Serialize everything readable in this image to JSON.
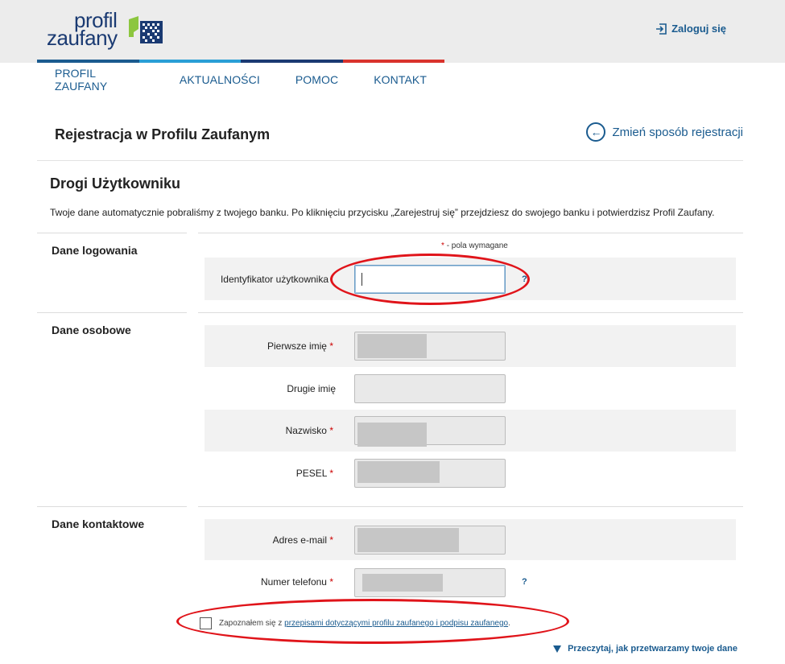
{
  "header": {
    "logo_line1": "profil",
    "logo_line2": "zaufany",
    "login_label": "Zaloguj się",
    "colorbar_colors": [
      "#1a5b8f",
      "#2a9fd6",
      "#1a3a72",
      "#d9332c"
    ]
  },
  "nav": {
    "items": [
      {
        "label": "PROFIL ZAUFANY"
      },
      {
        "label": "AKTUALNOŚCI"
      },
      {
        "label": "POMOC"
      },
      {
        "label": "KONTAKT"
      }
    ]
  },
  "page": {
    "title": "Rejestracja w Profilu Zaufanym",
    "change_label": "Zmień sposób rejestracji",
    "greeting": "Drogi Użytkowniku",
    "intro": "Twoje dane automatycznie pobraliśmy z twojego banku. Po kliknięciu przycisku „Zarejestruj się” przejdziesz do swojego banku i potwierdzisz Profil Zaufany.",
    "required_note": "- pola wymagane",
    "required_star": "*"
  },
  "sections": {
    "login": {
      "title": "Dane logowania",
      "username_label": "Identyfikator użytkownika",
      "username_value": "",
      "help": "?"
    },
    "personal": {
      "title": "Dane osobowe",
      "first_name_label": "Pierwsze imię",
      "second_name_label": "Drugie imię",
      "surname_label": "Nazwisko",
      "pesel_label": "PESEL"
    },
    "contact": {
      "title": "Dane kontaktowe",
      "email_label": "Adres e-mail",
      "phone_label": "Numer telefonu",
      "help": "?"
    }
  },
  "consent": {
    "prefix": "Zapoznałem się z",
    "link": "przepisami dotyczącymi profilu zaufanego i podpisu zaufanego",
    "suffix": ".",
    "checked": false
  },
  "footer": {
    "read_more": "Przeczytaj, jak przetwarzamy twoje dane"
  },
  "annotations": {
    "highlight_color": "#e0141a"
  }
}
